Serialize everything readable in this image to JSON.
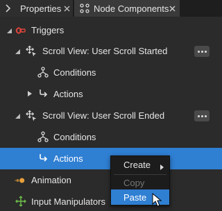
{
  "tabs": [
    {
      "label": "Properties"
    },
    {
      "label": "Node Components"
    }
  ],
  "tree": [
    {
      "label": "Triggers"
    },
    {
      "label": "Scroll View: User Scroll Started"
    },
    {
      "label": "Conditions"
    },
    {
      "label": "Actions"
    },
    {
      "label": "Scroll View: User Scroll Ended"
    },
    {
      "label": "Conditions"
    },
    {
      "label": "Actions"
    },
    {
      "label": "Animation"
    },
    {
      "label": "Input Manipulators"
    }
  ],
  "context_menu": {
    "create": "Create",
    "copy": "Copy",
    "paste": "Paste"
  },
  "colors": {
    "selection": "#2f7fd3",
    "triggers_icon": "#e0443c",
    "animation_icon": "#e8a03a",
    "input_icon": "#6fc04a"
  }
}
